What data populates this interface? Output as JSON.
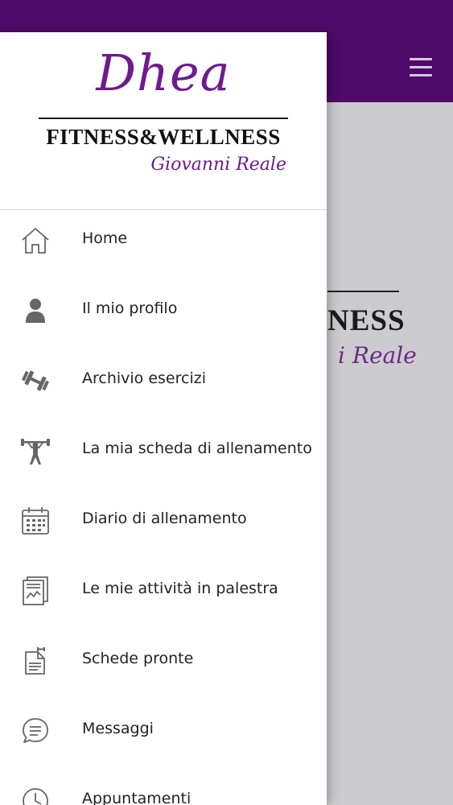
{
  "brand": {
    "script": "Dhea",
    "main": "FITNESS&WELLNESS",
    "sub": "Giovanni Reale"
  },
  "background": {
    "partial_main": "NESS",
    "partial_sub": "i Reale"
  },
  "colors": {
    "header": "#4e0b69",
    "brand_purple": "#6f1a8f",
    "content_bg": "#cccbcf",
    "icon_gray": "#666666"
  },
  "menu": {
    "items": [
      {
        "label": "Home",
        "icon": "home-icon"
      },
      {
        "label": "Il mio profilo",
        "icon": "user-icon"
      },
      {
        "label": "Archivio esercizi",
        "icon": "dumbbell-icon"
      },
      {
        "label": "La mia scheda di allenamento",
        "icon": "weightlifter-icon"
      },
      {
        "label": "Diario di allenamento",
        "icon": "calendar-icon"
      },
      {
        "label": "Le mie attività in palestra",
        "icon": "activity-report-icon"
      },
      {
        "label": "Schede pronte",
        "icon": "workout-sheet-icon"
      },
      {
        "label": "Messaggi",
        "icon": "message-icon"
      },
      {
        "label": "Appuntamenti",
        "icon": "clock-icon"
      }
    ]
  }
}
